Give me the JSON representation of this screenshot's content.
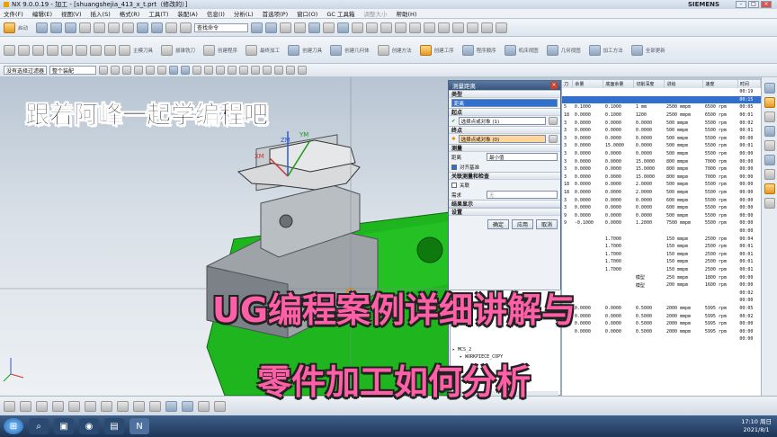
{
  "window": {
    "title": "NX 9.0.0.19 - 加工 - [shuangshejia_413_x_t.prt（修改的）]",
    "brand": "SIEMENS",
    "min": "-",
    "max": "□",
    "close": "×"
  },
  "menu": [
    "文件(F)",
    "编辑(E)",
    "视图(V)",
    "插入(S)",
    "格式(R)",
    "工具(T)",
    "装配(A)",
    "信息(I)",
    "分析(L)",
    "首选项(P)",
    "窗口(O)",
    "GC 工具箱",
    "调整大小",
    "帮助(H)"
  ],
  "start_label": "启动",
  "toolbar": {
    "command_finder_placeholder": "查找命令",
    "labels": [
      "主模刀具",
      "拔锥铣刀",
      "创建程序",
      "最终加工",
      "创建刀具",
      "创建几何体",
      "创建方法",
      "创建工序",
      "程序顺序",
      "机床视图",
      "几何视图",
      "加工方法",
      "全部更新"
    ],
    "selection_filter": "没有选择过滤器",
    "assembly_scope": "整个装配"
  },
  "dialog": {
    "title": "测量距离",
    "type_section": "类型",
    "type_value": "距离",
    "start_section": "起点",
    "start_label": "选择点或对象 (1)",
    "end_section": "终点",
    "end_label": "选择点或对象 (0)",
    "measure_section": "测量",
    "distance_label": "距离",
    "distance_value": "最小值",
    "align_label": "对齐基准",
    "associate_section": "关联测量和检查",
    "associate_label": "关联",
    "requirement_label": "需求",
    "requirement_value": "无",
    "result_section": "结果显示",
    "settings_section": "设置",
    "btn_ok": "确定",
    "btn_apply": "应用",
    "btn_cancel": "取消"
  },
  "nav": {
    "items": [
      "MCS_2",
      "WORKPIECE_COPY"
    ],
    "footer": "细节"
  },
  "table": {
    "headers": [
      "刀",
      "余量",
      "底面余量",
      "切削深度",
      "进给",
      "速度",
      "时间"
    ],
    "rows": [
      [
        "",
        "",
        "",
        "",
        "",
        "",
        "00:19"
      ],
      [
        "",
        "",
        "",
        "",
        "",
        "",
        "00:15"
      ],
      [
        "5",
        "0.1000",
        "0.1000",
        "1 mm",
        "2500 mmpm",
        "6500 rpm",
        "00:05"
      ],
      [
        "18",
        "0.0000",
        "0.1000",
        "1200",
        "2500 mmpm",
        "6500 rpm",
        "00:01"
      ],
      [
        "3",
        "0.0000",
        "0.0000",
        "0.0000",
        "500 mmpm",
        "5500 rpm",
        "00:02"
      ],
      [
        "3",
        "0.0000",
        "0.0000",
        "0.0000",
        "500 mmpm",
        "5500 rpm",
        "00:01"
      ],
      [
        "3",
        "0.0000",
        "0.0000",
        "0.0000",
        "500 mmpm",
        "5500 rpm",
        "00:00"
      ],
      [
        "3",
        "0.0000",
        "15.0000",
        "0.0000",
        "500 mmpm",
        "5500 rpm",
        "00:01"
      ],
      [
        "3",
        "0.0000",
        "0.0000",
        "0.0000",
        "500 mmpm",
        "5500 rpm",
        "00:00"
      ],
      [
        "3",
        "0.0000",
        "0.0000",
        "15.0000",
        "800 mmpm",
        "7000 rpm",
        "00:00"
      ],
      [
        "3",
        "0.0000",
        "0.0000",
        "15.0000",
        "800 mmpm",
        "7000 rpm",
        "00:00"
      ],
      [
        "3",
        "0.0000",
        "0.0000",
        "15.0000",
        "800 mmpm",
        "7000 rpm",
        "00:00"
      ],
      [
        "18",
        "0.0000",
        "0.0000",
        "2.0000",
        "500 mmpm",
        "5500 rpm",
        "00:00"
      ],
      [
        "18",
        "0.0000",
        "0.0000",
        "2.0000",
        "500 mmpm",
        "5500 rpm",
        "00:00"
      ],
      [
        "3",
        "0.0000",
        "0.0000",
        "0.0000",
        "600 mmpm",
        "5500 rpm",
        "00:00"
      ],
      [
        "3",
        "0.0000",
        "0.0000",
        "0.0000",
        "600 mmpm",
        "5500 rpm",
        "00:00"
      ],
      [
        "9",
        "0.0000",
        "0.0000",
        "0.0000",
        "500 mmpm",
        "5500 rpm",
        "00:00"
      ],
      [
        "9",
        "-0.1000",
        "0.0000",
        "1.2000",
        "7500 mmpm",
        "5500 rpm",
        "00:00"
      ],
      [
        "",
        "",
        "",
        "",
        "",
        "",
        "00:00"
      ],
      [
        "",
        "",
        "1.7000",
        "",
        "150 mmpm",
        "2500 rpm",
        "00:04"
      ],
      [
        "",
        "",
        "1.7000",
        "",
        "150 mmpm",
        "2500 rpm",
        "00:01"
      ],
      [
        "",
        "",
        "1.7000",
        "",
        "150 mmpm",
        "2500 rpm",
        "00:01"
      ],
      [
        "",
        "",
        "1.7000",
        "",
        "150 mmpm",
        "2500 rpm",
        "00:01"
      ],
      [
        "",
        "",
        "1.7000",
        "",
        "150 mmpm",
        "2500 rpm",
        "00:01"
      ],
      [
        "",
        "",
        "",
        "模型",
        "250 mmpm",
        "1800 rpm",
        "00:00"
      ],
      [
        "",
        "",
        "",
        "模型",
        "200 mmpm",
        "1600 rpm",
        "00:00"
      ],
      [
        "",
        "",
        "",
        "",
        "",
        "",
        "00:02"
      ],
      [
        "",
        "",
        "",
        "",
        "",
        "",
        "00:00"
      ],
      [
        "",
        "0.0000",
        "0.0000",
        "0.5000",
        "2000 mmpm",
        "5995 rpm",
        "00:05"
      ],
      [
        "",
        "0.0000",
        "0.0000",
        "0.5000",
        "2000 mmpm",
        "5995 rpm",
        "00:02"
      ],
      [
        "",
        "0.0000",
        "0.0000",
        "0.5000",
        "2000 mmpm",
        "5995 rpm",
        "00:00"
      ],
      [
        "",
        "0.0000",
        "0.0000",
        "0.5000",
        "2000 mmpm",
        "5995 rpm",
        "00:00"
      ],
      [
        "",
        "",
        "",
        "",
        "",
        "",
        "00:00"
      ]
    ]
  },
  "overlays": {
    "top_left": "跟着阿峰一起学编程吧",
    "line1": "UG编程案例详细讲解与",
    "line2": "零件加工如何分析"
  },
  "axes": {
    "zm": "ZM",
    "ym": "YM",
    "xm": "XM"
  },
  "taskbar": {
    "time": "17:10 周日",
    "date": "2021/8/1"
  },
  "colors": {
    "accent": "#2f6fd0",
    "part_green": "#1fb51f",
    "title_pink": "#ff5fa6"
  }
}
